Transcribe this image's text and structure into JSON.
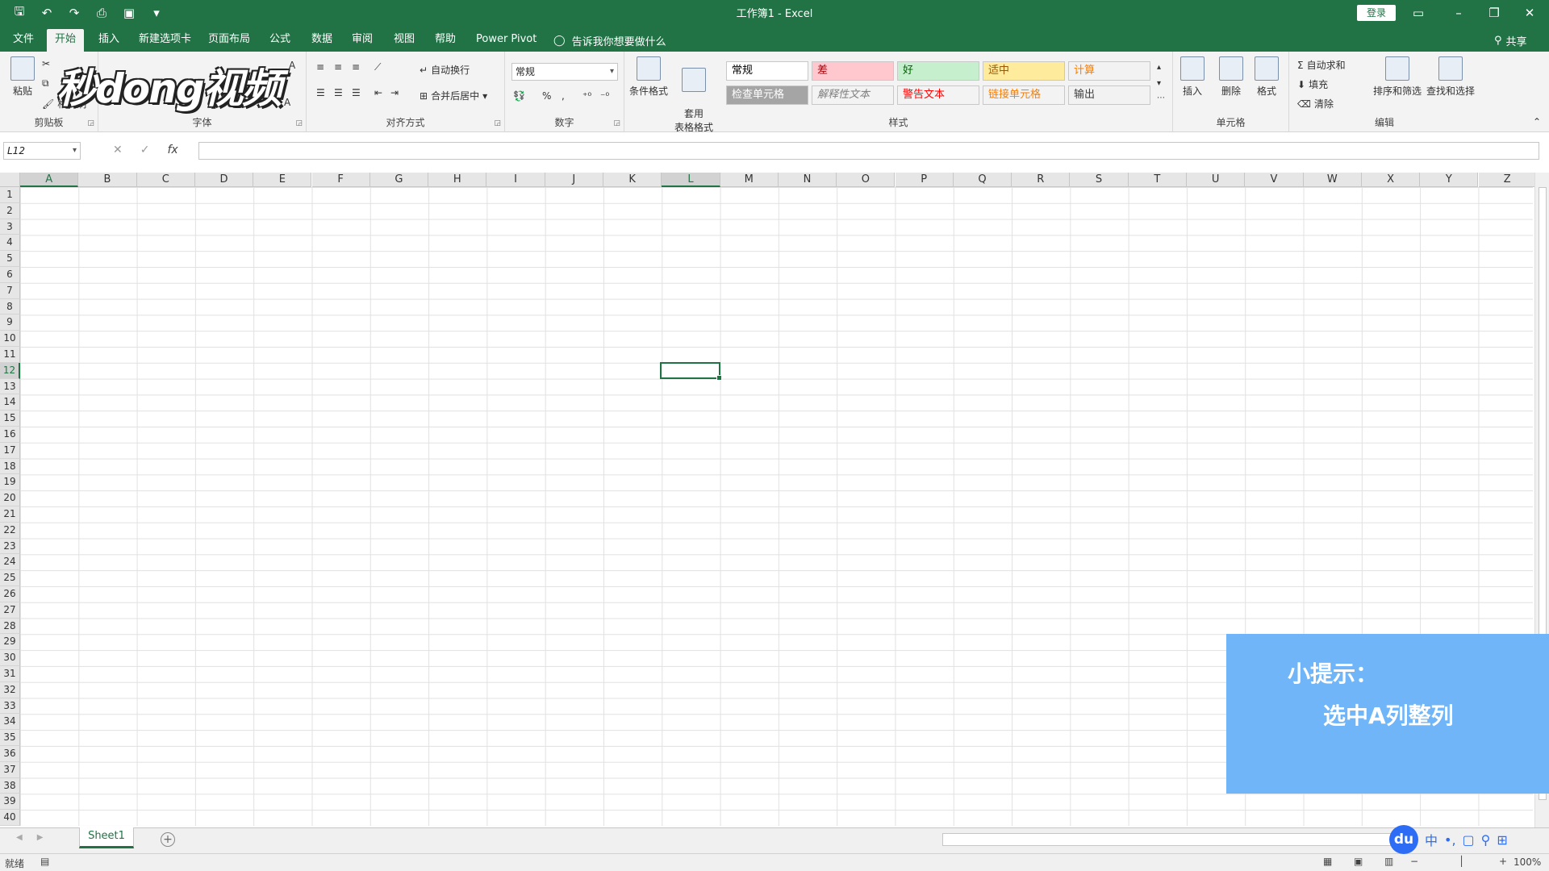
{
  "window": {
    "title": "工作簿1 - Excel",
    "login_label": "登录",
    "share_label": "共享"
  },
  "menu": {
    "tabs": [
      "文件",
      "开始",
      "插入",
      "新建选项卡",
      "页面布局",
      "公式",
      "数据",
      "审阅",
      "视图",
      "帮助",
      "Power Pivot"
    ],
    "active_tab": "开始",
    "tell_me": "告诉我你想要做什么"
  },
  "ribbon": {
    "clipboard": {
      "label": "剪贴板",
      "paste": "粘贴",
      "format_painter": "格式刷"
    },
    "font": {
      "label": "字体"
    },
    "alignment": {
      "label": "对齐方式",
      "wrap": "自动换行",
      "merge": "合并后居中"
    },
    "number": {
      "label": "数字",
      "format": "常规",
      "percent": "%"
    },
    "styles": {
      "label": "样式",
      "conditional": "条件格式",
      "table": "套用\n表格格式",
      "cells": [
        {
          "text": "常规",
          "bg": "#ffffff",
          "color": "#000000"
        },
        {
          "text": "差",
          "bg": "#ffc7ce",
          "color": "#9c0006"
        },
        {
          "text": "好",
          "bg": "#c6efce",
          "color": "#006100"
        },
        {
          "text": "适中",
          "bg": "#ffeb9c",
          "color": "#9c5700"
        },
        {
          "text": "计算",
          "bg": "#f2f2f2",
          "color": "#fa7d00"
        },
        {
          "text": "检查单元格",
          "bg": "#a5a5a5",
          "color": "#ffffff"
        },
        {
          "text": "解释性文本",
          "bg": "#f3f3f3",
          "color": "#7f7f7f"
        },
        {
          "text": "警告文本",
          "bg": "#f3f3f3",
          "color": "#ff0000"
        },
        {
          "text": "链接单元格",
          "bg": "#f3f3f3",
          "color": "#fa7d00"
        },
        {
          "text": "输出",
          "bg": "#f2f2f2",
          "color": "#3f3f3f"
        }
      ]
    },
    "cells": {
      "label": "单元格",
      "insert": "插入",
      "delete": "删除",
      "format": "格式"
    },
    "editing": {
      "label": "编辑",
      "autosum": "自动求和",
      "fill": "填充",
      "clear": "清除",
      "sort": "排序和筛选",
      "find": "查找和选择"
    }
  },
  "formula_bar": {
    "name_box": "L12",
    "fx": "fx",
    "cancel": "✕",
    "confirm": "✓"
  },
  "grid": {
    "columns": [
      "A",
      "B",
      "C",
      "D",
      "E",
      "F",
      "G",
      "H",
      "I",
      "J",
      "K",
      "L",
      "M",
      "N",
      "O",
      "P",
      "Q",
      "R",
      "S",
      "T",
      "U",
      "V",
      "W",
      "X",
      "Y",
      "Z"
    ],
    "rows": [
      "1",
      "2",
      "3",
      "4",
      "5",
      "6",
      "7",
      "8",
      "9",
      "10",
      "11",
      "12",
      "13",
      "14",
      "15",
      "16",
      "17",
      "18",
      "19",
      "20",
      "21",
      "22",
      "23",
      "24",
      "25",
      "26",
      "27",
      "28",
      "29",
      "30",
      "31",
      "32",
      "33",
      "34",
      "35",
      "36",
      "37",
      "38",
      "39",
      "40"
    ],
    "active_column": "L",
    "highlight_column": "A",
    "active_row": "12"
  },
  "sheets": {
    "tabs": [
      "Sheet1"
    ],
    "add": "+"
  },
  "status": {
    "ready": "就绪",
    "zoom": "100%"
  },
  "tip": {
    "title": "小提示：",
    "body": "选中A列整列"
  },
  "watermark": {
    "text": "秒dong视频"
  },
  "ime": {
    "du": "du",
    "lang": "中"
  }
}
